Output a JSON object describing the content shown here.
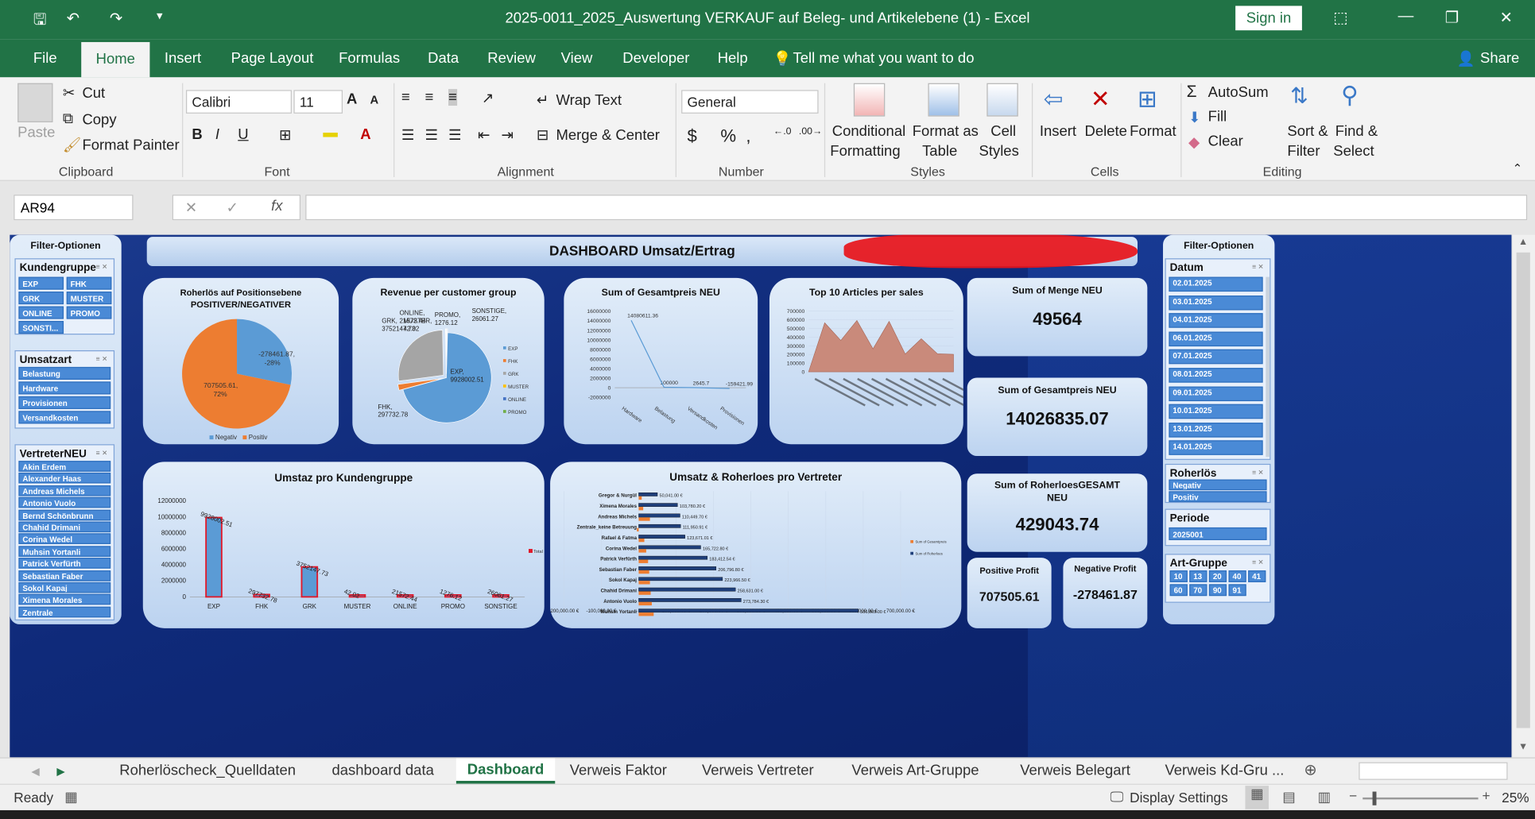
{
  "window": {
    "title": "2025-0011_2025_Auswertung VERKAUF auf Beleg- und Artikelebene (1)  -  Excel",
    "sign_in": "Sign in"
  },
  "menu": {
    "tabs": [
      "File",
      "Home",
      "Insert",
      "Page Layout",
      "Formulas",
      "Data",
      "Review",
      "View",
      "Developer",
      "Help"
    ],
    "tell_me": "Tell me what you want to do",
    "share": "Share"
  },
  "ribbon": {
    "clipboard": {
      "paste": "Paste",
      "cut": "Cut",
      "copy": "Copy",
      "format_painter": "Format Painter",
      "group": "Clipboard"
    },
    "font": {
      "name": "Calibri",
      "size": "11",
      "group": "Font"
    },
    "alignment": {
      "wrap": "Wrap Text",
      "merge": "Merge & Center",
      "group": "Alignment"
    },
    "number": {
      "format": "General",
      "group": "Number",
      "dec_inc": ".0\n.00",
      "dollar": "$",
      "percent": "%"
    },
    "styles": {
      "conditional": "Conditional",
      "formatting": "Formatting",
      "format_as": "Format as",
      "table": "Table",
      "cell": "Cell",
      "cell_styles": "Styles",
      "group": "Styles"
    },
    "cells": {
      "insert": "Insert",
      "delete": "Delete",
      "format": "Format",
      "group": "Cells"
    },
    "editing": {
      "autosum": "AutoSum",
      "fill": "Fill",
      "clear": "Clear",
      "sort": "Sort &",
      "filter": "Filter",
      "find": "Find &",
      "select": "Select",
      "group": "Editing"
    }
  },
  "formula": {
    "name_box": "AR94",
    "fx": "fx",
    "value": ""
  },
  "dashboard": {
    "title": "DASHBOARD Umsatz/Ertrag",
    "left_filter_title": "Filter-Optionen",
    "right_filter_title": "Filter-Optionen",
    "kundengruppe": {
      "title": "Kundengruppe",
      "items": [
        "EXP",
        "FHK",
        "GRK",
        "MUSTER",
        "ONLINE",
        "PROMO",
        "SONSTI..."
      ]
    },
    "umsatzart": {
      "title": "Umsatzart",
      "items": [
        "Belastung",
        "Hardware",
        "Provisionen",
        "Versandkosten"
      ]
    },
    "vertreter": {
      "title": "VertreterNEU",
      "items": [
        "Akin Erdem",
        "Alexander Haas",
        "Andreas Michels",
        "Antonio Vuolo",
        "Bernd Schönbrunn",
        "Chahid Drimani",
        "Corina Wedel",
        "Muhsin Yortanli",
        "Patrick Verfürth",
        "Sebastian Faber",
        "Sokol Kapaj",
        "Ximena Morales",
        "Zentrale"
      ]
    },
    "datum": {
      "title": "Datum",
      "items": [
        "02.01.2025",
        "03.01.2025",
        "04.01.2025",
        "06.01.2025",
        "07.01.2025",
        "08.01.2025",
        "09.01.2025",
        "10.01.2025",
        "13.01.2025",
        "14.01.2025"
      ]
    },
    "roherloes": {
      "title": "Roherlös",
      "items": [
        "Negativ",
        "Positiv"
      ]
    },
    "periode": {
      "title": "Periode",
      "items": [
        "2025001"
      ]
    },
    "artgruppe": {
      "title": "Art-Gruppe",
      "items": [
        "10",
        "13",
        "20",
        "40",
        "41",
        "60",
        "70",
        "90",
        "91"
      ]
    },
    "kpis": {
      "menge_label": "Sum of Menge NEU",
      "menge_value": "49564",
      "gesamtpreis_label": "Sum of Gesamtpreis NEU",
      "gesamtpreis_value": "14026835.07",
      "roherloes_label": "Sum of RoherloesGESAMT NEU",
      "roherloes_value": "429043.74",
      "pos_label": "Positive Profit",
      "pos_value": "707505.61",
      "neg_label": "Negative Profit",
      "neg_value": "-278461.87"
    }
  },
  "chart_data": [
    {
      "type": "pie",
      "title": "Roherlös auf Positionsebene POSITIVER/NEGATIVER",
      "categories": [
        "Negativ",
        "Positiv"
      ],
      "values": [
        -278461.87,
        707505.61
      ],
      "labels": [
        "-278461.87, -28%",
        "707505.61, 72%"
      ],
      "colors": [
        "#5b9bd5",
        "#ed7d31"
      ],
      "legend": "bottom"
    },
    {
      "type": "pie",
      "title": "Revenue per customer group",
      "categories": [
        "EXP",
        "FHK",
        "GRK",
        "MUSTER",
        "ONLINE",
        "PROMO"
      ],
      "values": [
        9928002.51,
        297732.78,
        3752147.73,
        42.02,
        21572.44,
        1276.12,
        26061.27
      ],
      "labels": [
        "EXP, 9928002.51",
        "FHK, 297732.78",
        "GRK, 3752147.73",
        "MUSTER, 42.02",
        "ONLINE, 21572.44",
        "PROMO, 1276.12",
        "SONSTIGE, 26061.27"
      ],
      "legend": "right"
    },
    {
      "type": "line",
      "title": "Sum of Gesamtpreis NEU",
      "categories": [
        "Hardware",
        "Belastung",
        "Versandkosten",
        "Provisionen"
      ],
      "values": [
        14080611.36,
        100000,
        2645.7,
        -159421.99
      ],
      "labels": [
        "14080611.36",
        "100000",
        "2645.7",
        "-159421.99"
      ],
      "ylim": [
        -2000000,
        16000000
      ],
      "yticks": [
        "16000000",
        "14000000",
        "12000000",
        "10000000",
        "8000000",
        "6000000",
        "4000000",
        "2000000",
        "0",
        "-2000000"
      ]
    },
    {
      "type": "area",
      "title": "Top 10 Articles per sales",
      "values": [
        0,
        565645,
        362222,
        592356,
        265623,
        582208,
        205437,
        382359,
        208520,
        202322
      ],
      "yticks": [
        "700000",
        "600000",
        "500000",
        "400000",
        "300000",
        "200000",
        "100000",
        "0"
      ],
      "ylim": [
        0,
        700000
      ]
    },
    {
      "type": "bar",
      "title": "Umstaz pro Kundengruppe",
      "categories": [
        "EXP",
        "FHK",
        "GRK",
        "MUSTER",
        "ONLINE",
        "PROMO",
        "SONSTIGE"
      ],
      "values": [
        9928002.51,
        297732.78,
        3752147.73,
        42.02,
        21572.44,
        1276.12,
        26061.27
      ],
      "labels": [
        "9928002.51",
        "297732.78",
        "3752147.73",
        "42.02",
        "21572.44",
        "1276.12",
        "26061.27"
      ],
      "yticks": [
        "12000000",
        "10000000",
        "8000000",
        "6000000",
        "4000000",
        "2000000",
        "0"
      ],
      "ylim": [
        0,
        12000000
      ],
      "legend": "Total"
    },
    {
      "type": "bar",
      "title": "Umsatz & Roherloes pro Vertreter",
      "categories": [
        "Gregor & Nurgül",
        "Ximena Morales",
        "Andreas Michels",
        "Zentrale_keine Betreuung",
        "Rafael & Fatma",
        "Corina Wedel",
        "Patrick Verfürth",
        "Sebastian Faber",
        "Sokol Kapaj",
        "Chahid Drimani",
        "Antonio Vuolo",
        "Muhsin Yortanli"
      ],
      "series": [
        {
          "name": "Sum of Gesamtpreis",
          "values": [
            50041,
            103780,
            110449.7,
            111950.91,
            123671.01,
            165722.8,
            183412.54,
            206796.8,
            223966.5,
            258631,
            273784.3,
            586869
          ]
        },
        {
          "name": "Sum of Roherloes",
          "values": [
            8000,
            12000,
            30000,
            -5000,
            15000,
            20000,
            25000,
            28000,
            30000,
            32000,
            35000,
            40000
          ]
        }
      ],
      "labels": [
        "50,041.00 €",
        "103,780.20 €",
        "110,449.70 €",
        "111,950.91 €",
        "123,671.01 €",
        "165,722.80 €",
        "183,412.54 €",
        "206,796.80 €",
        "223,966.50 €",
        "258,631.00 €",
        "273,784.30 €",
        "586,869.00 €"
      ],
      "xticks": [
        "-200,000.00 €",
        "-100,000.00 €",
        "-   €",
        "100,000.00 €",
        "200,000.00 €",
        "300,000.00 €",
        "400,000.00 €",
        "500,000.00 €",
        "600,000.00 €",
        "700,000.00 €"
      ],
      "xlim": [
        -200000,
        700000
      ]
    }
  ],
  "sheet_tabs": [
    "Roherlöscheck_Quelldaten",
    "dashboard data",
    "Dashboard",
    "Verweis Faktor",
    "Verweis Vertreter",
    "Verweis Art-Gruppe",
    "Verweis Belegart",
    "Verweis Kd-Gru ..."
  ],
  "status": {
    "ready": "Ready",
    "display_settings": "Display Settings",
    "zoom": "25%"
  }
}
